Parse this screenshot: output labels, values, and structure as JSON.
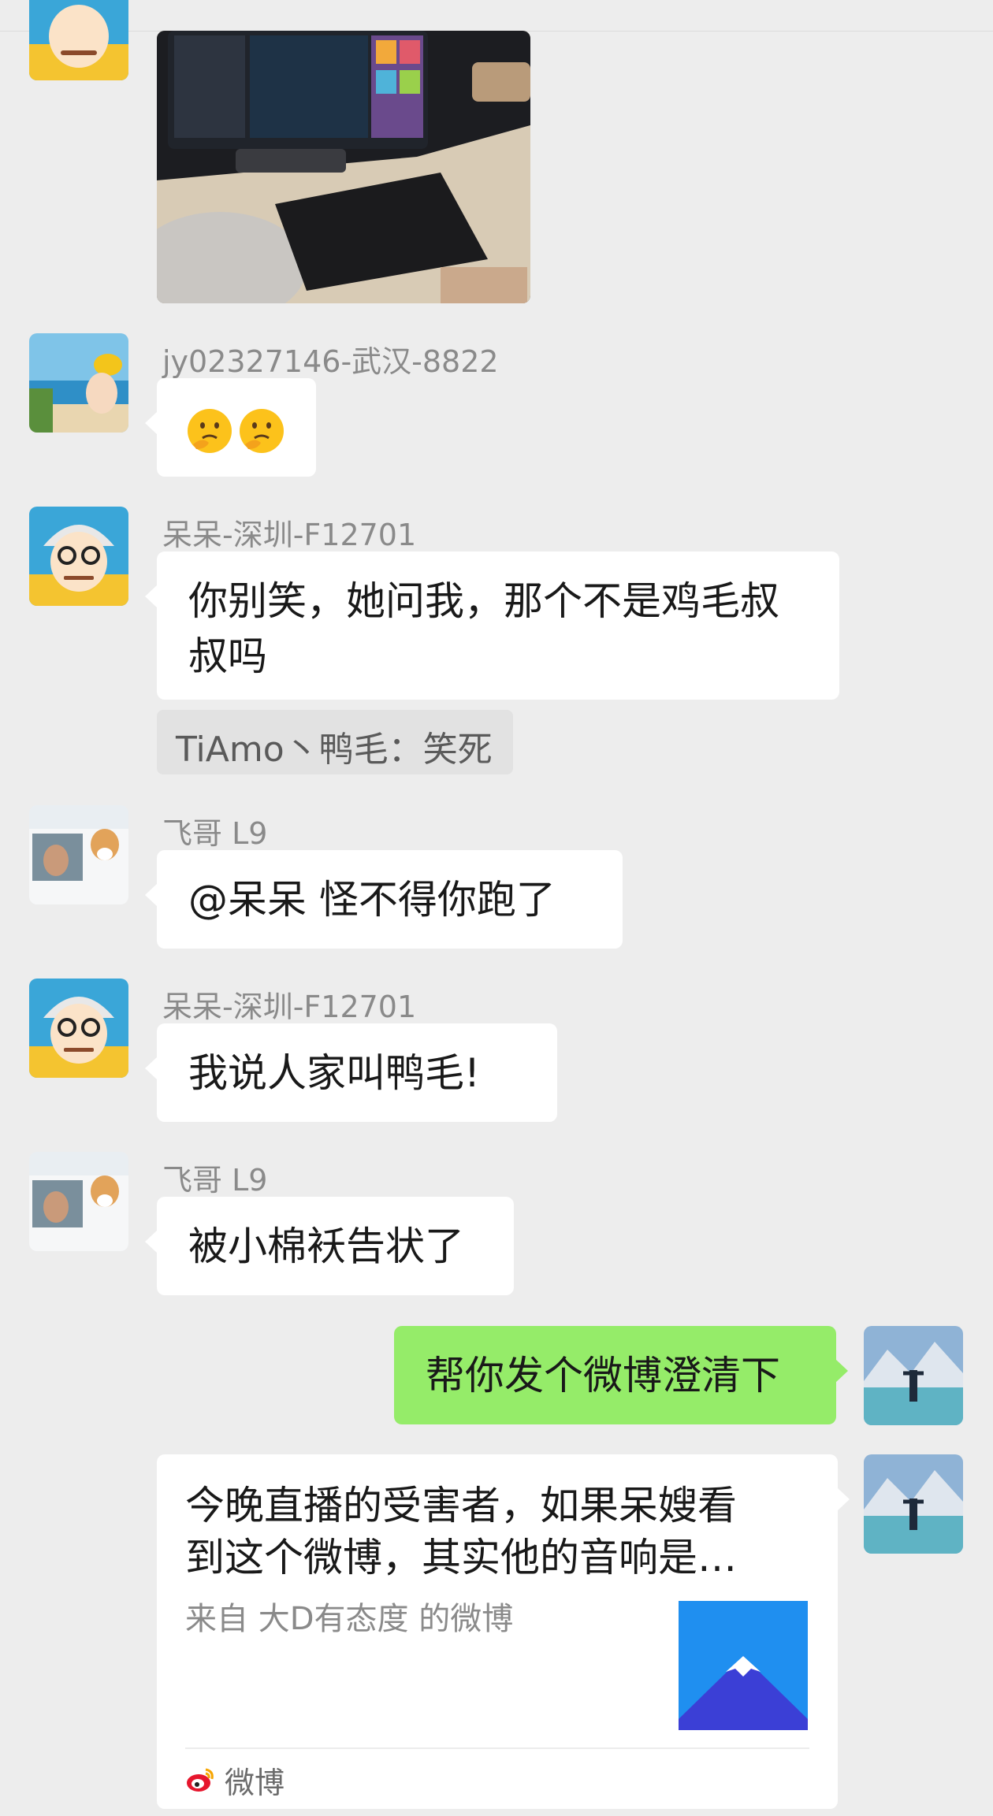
{
  "messages": [
    {
      "sender": "jy02327146-武汉-8822",
      "emoji": [
        "thinking-face-emoji",
        "thinking-face-emoji"
      ]
    },
    {
      "sender": "呆呆-深圳-F12701",
      "text_line1": "你别笑，她问我，那个不是鸡毛叔",
      "text_line2": "叔吗",
      "quote": "TiAmo丶鸭毛：笑死"
    },
    {
      "sender": "飞哥 L9",
      "text": "@呆呆  怪不得你跑了"
    },
    {
      "sender": "呆呆-深圳-F12701",
      "text": "我说人家叫鸭毛!"
    },
    {
      "sender": "飞哥 L9",
      "text": "被小棉袄告状了"
    },
    {
      "sender": "self",
      "text": "帮你发个微博澄清下"
    }
  ],
  "share_card": {
    "title_line1": "今晚直播的受害者，如果呆嫂看",
    "title_line2": "到这个微博，其实他的音响是…",
    "source": "来自 大D有态度 的微博",
    "app_name": "微博",
    "app_icon": "weibo-icon"
  },
  "colors": {
    "background": "#ededed",
    "bubble_self": "#95ec69",
    "bubble_other": "#ffffff",
    "name_text": "#8a8a8a"
  }
}
